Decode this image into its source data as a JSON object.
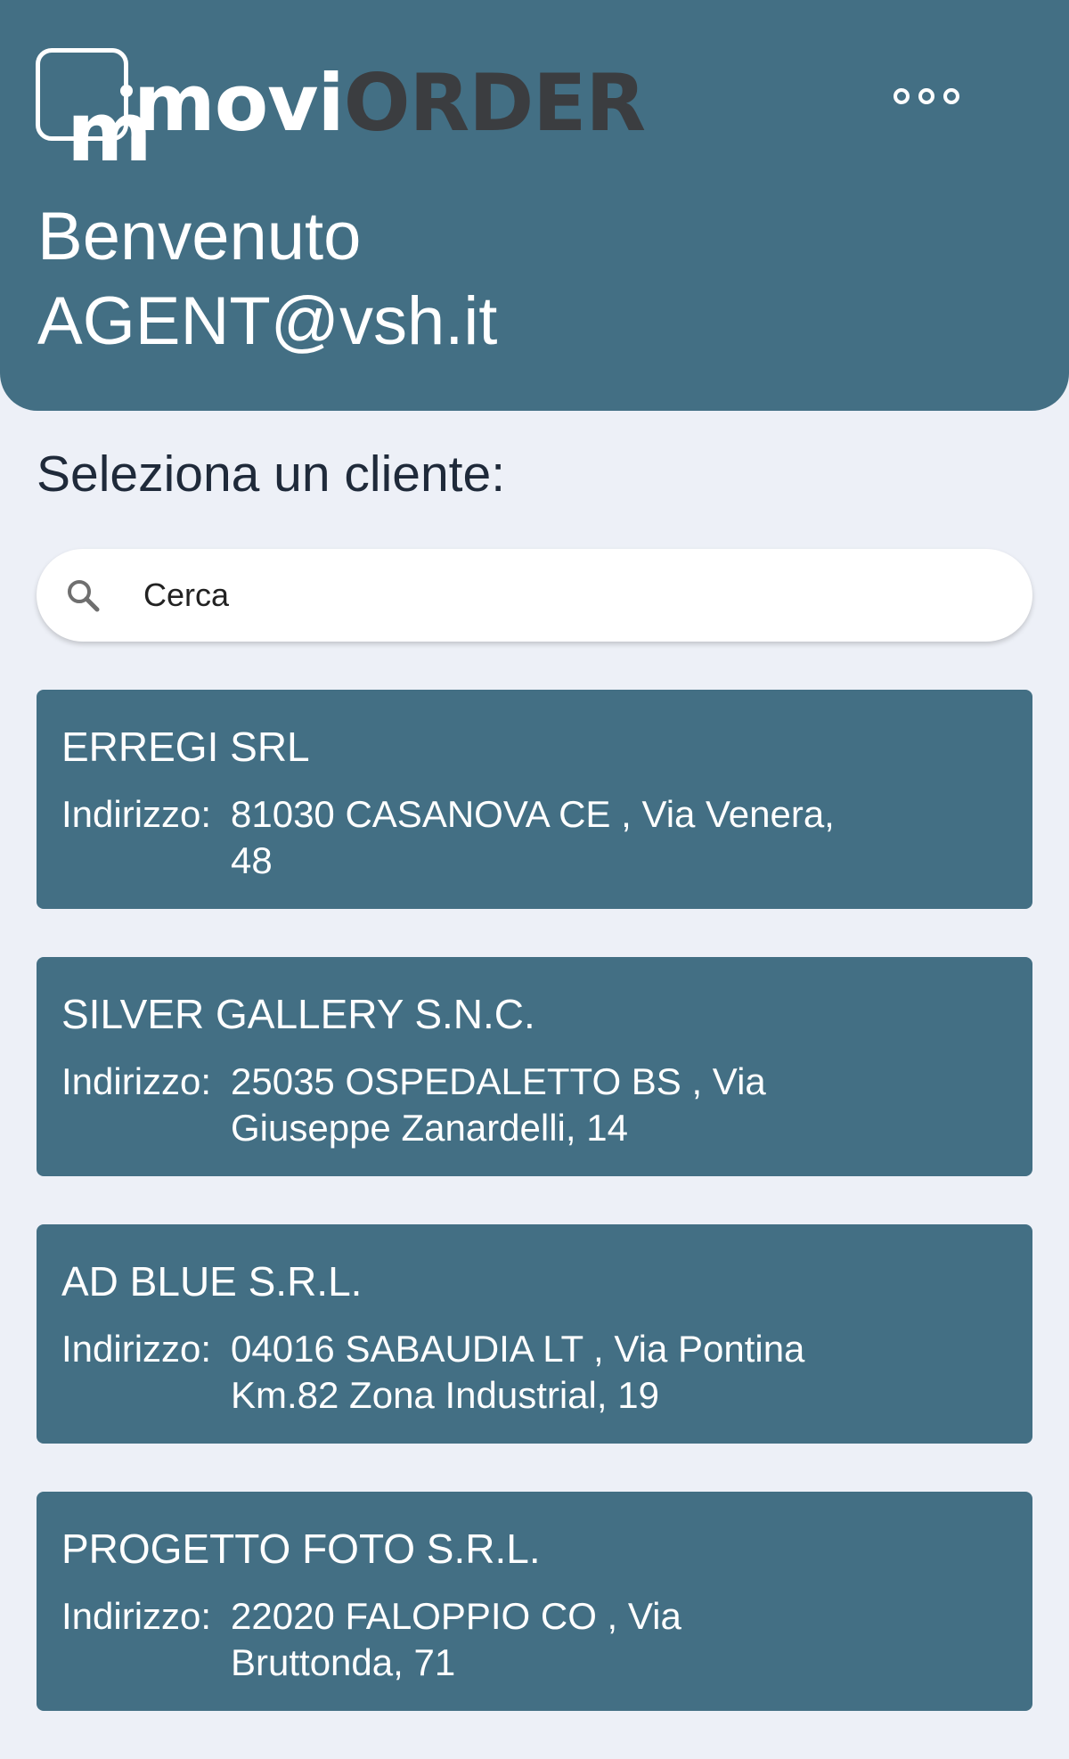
{
  "app": {
    "logo_movi": "movi",
    "logo_order": "ORDER",
    "logo_mark": "m"
  },
  "header": {
    "welcome_line1": "Benvenuto",
    "welcome_line2": "AGENT@vsh.it",
    "menu_icon": "more-horizontal-icon"
  },
  "main": {
    "select_label": "Seleziona un cliente:",
    "search": {
      "placeholder": "Cerca",
      "value": "",
      "icon": "search-icon"
    },
    "address_label": "Indirizzo:",
    "clients": [
      {
        "name": "ERREGI SRL",
        "address": "81030 CASANOVA CE , Via Venera, 48"
      },
      {
        "name": "SILVER GALLERY S.N.C.",
        "address": "25035 OSPEDALETTO BS , Via Giuseppe Zanardelli, 14"
      },
      {
        "name": "AD BLUE S.R.L.",
        "address": "04016 SABAUDIA LT , Via Pontina Km.82 Zona Industrial, 19"
      },
      {
        "name": "PROGETTO FOTO S.R.L.",
        "address": "22020 FALOPPIO CO , Via Bruttonda, 71"
      }
    ]
  },
  "colors": {
    "header_bg": "#436f84",
    "page_bg": "#edf0f7",
    "card_bg": "#436f84",
    "logo_order": "#3b3d40"
  }
}
